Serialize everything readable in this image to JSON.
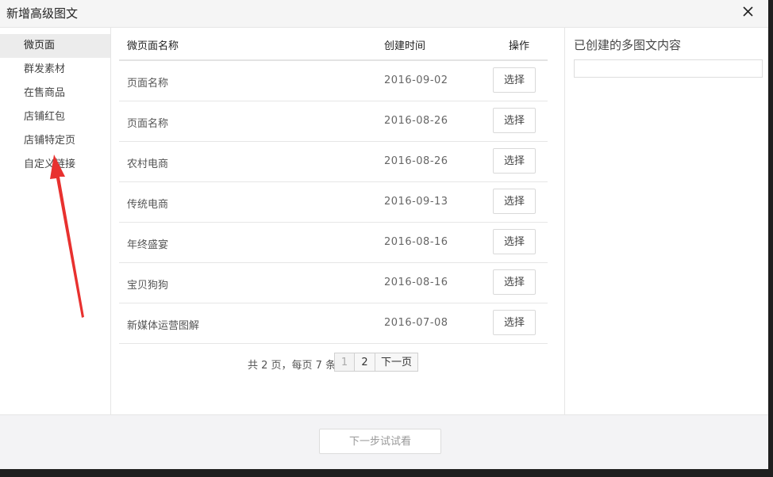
{
  "dialog": {
    "title": "新增高级图文",
    "close_glyph": "✕"
  },
  "sidebar": {
    "items": [
      {
        "label": "微页面",
        "active": true
      },
      {
        "label": "群发素材",
        "active": false
      },
      {
        "label": "在售商品",
        "active": false
      },
      {
        "label": "店铺红包",
        "active": false
      },
      {
        "label": "店铺特定页",
        "active": false
      },
      {
        "label": "自定义链接",
        "active": false
      }
    ]
  },
  "table": {
    "headers": {
      "name": "微页面名称",
      "date": "创建时间",
      "action": "操作"
    },
    "rows": [
      {
        "name": "页面名称",
        "date": "2016-09-02",
        "action": "选择"
      },
      {
        "name": "页面名称",
        "date": "2016-08-26",
        "action": "选择"
      },
      {
        "name": "农村电商",
        "date": "2016-08-26",
        "action": "选择"
      },
      {
        "name": "传统电商",
        "date": "2016-09-13",
        "action": "选择"
      },
      {
        "name": "年终盛宴",
        "date": "2016-08-16",
        "action": "选择"
      },
      {
        "name": "宝贝狗狗",
        "date": "2016-08-16",
        "action": "选择"
      },
      {
        "name": "新媒体运营图解",
        "date": "2016-07-08",
        "action": "选择"
      }
    ]
  },
  "pagination": {
    "info": "共 2 页，每页 7 条",
    "pages": [
      "1",
      "2"
    ],
    "current_page": "1",
    "next_label": "下一页"
  },
  "right_panel": {
    "title": "已创建的多图文内容",
    "input_value": ""
  },
  "footer": {
    "next_step_label": "下一步试试看"
  },
  "colors": {
    "annotation_arrow": "#e8312f",
    "active_sidebar_bg": "#ececec",
    "footer_bg": "#f3f3f5"
  },
  "icons": {
    "close": "close-icon",
    "annotation": "arrow-annotation"
  }
}
